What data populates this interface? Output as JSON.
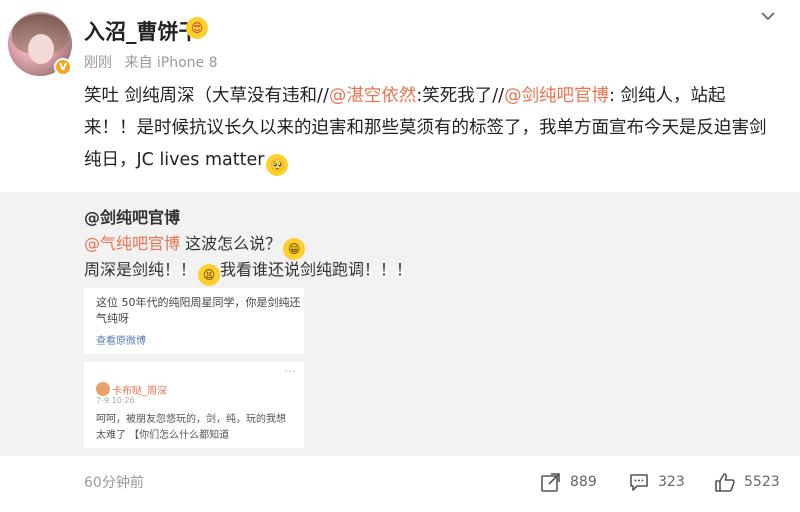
{
  "header": {
    "username": "入沼_曹饼干",
    "user_emoji": "😍",
    "time": "刚刚",
    "source": "来自 iPhone 8",
    "verified_badge": "V"
  },
  "post": {
    "p1": "笑吐 剑纯周深（大草没有违和//",
    "m1": "@湛空依然",
    "p2": ":笑死我了//",
    "m2": "@剑纯吧官博",
    "p3": ": 剑纯人，站起来！！是时候抗议长久以来的迫害和那些莫须有的标签了，我单方面宣布今天是反迫害剑纯日，JC lives matter",
    "end_emoji": "🥺"
  },
  "repost": {
    "author": "@剑纯吧官博",
    "mention": "@气纯吧官博",
    "line1_text": " 这波怎么说？",
    "line1_emoji": "😁",
    "line2_a": "周深是剑纯！！",
    "line2_emoji": "😫",
    "line2_b": "我看谁还说剑纯跑调！！！",
    "thumb": {
      "t1": "这位 50年代的纯阳周星同学，你是剑纯还",
      "t2": "气纯呀",
      "t3": "查看原微博",
      "more": "⋯",
      "name": "卡布哒_周深",
      "date": "7-9 10:26",
      "c1": "呵呵，被朋友忽悠玩的，剑，纯，玩的我想",
      "c2": "太难了 【你们怎么什么都知道"
    }
  },
  "footer": {
    "time": "60分钟前",
    "reposts": "889",
    "comments": "323",
    "likes": "5523"
  },
  "colors": {
    "mention": "#eb7350",
    "meta": "#999999",
    "repost_bg": "#f2f2f2"
  },
  "icons": [
    "chevron-down-icon",
    "share-icon",
    "comment-icon",
    "like-icon",
    "verified-icon"
  ]
}
